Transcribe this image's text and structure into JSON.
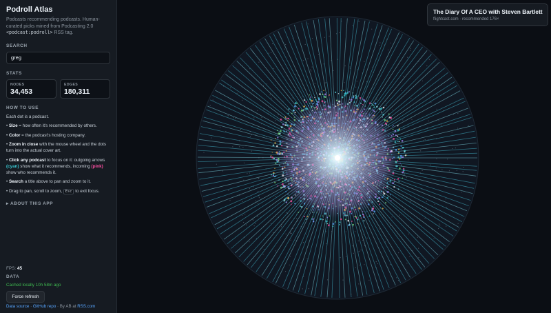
{
  "app": {
    "title": "Podroll Atlas",
    "desc_before": "Podcasts recommending podcasts. Human-curated picks mined from Podcasting 2.0 ",
    "desc_code": "<podcast:podroll>",
    "desc_after": " RSS tag."
  },
  "search": {
    "label": "SEARCH",
    "value": "greg"
  },
  "stats": {
    "label": "STATS",
    "nodes_label": "NODES",
    "nodes_value": "34,453",
    "edges_label": "EDGES",
    "edges_value": "180,311"
  },
  "howto": {
    "label": "HOW TO USE",
    "intro": "Each dot is a podcast.",
    "size_b": "Size",
    "size_t": " = how often it's recommended by others.",
    "color_b": "Color",
    "color_t": " = the podcast's hosting company.",
    "zoom_b": "Zoom in close",
    "zoom_t": " with the mouse wheel and the dots turn into the actual cover art.",
    "click_b": "Click any podcast",
    "click_t1": " to focus on it: outgoing arrows ",
    "cyan": "(cyan)",
    "click_t2": " show what it recommends, incoming ",
    "pink": "(pink)",
    "click_t3": " show who recommends it.",
    "search_b": "Search",
    "search_t": " a title above to pan and zoom to it.",
    "drag_t1": "Drag to pan, scroll to zoom, ",
    "drag_key": "Esc",
    "drag_t2": " to exit focus."
  },
  "about": "▸ ABOUT THIS APP",
  "fps": {
    "label": "FPS: ",
    "value": "45"
  },
  "data": {
    "label": "DATA",
    "cached": "Cached locally 10h 58m ago",
    "refresh": "Force refresh"
  },
  "footer": {
    "data_source": "Data source",
    "sep": " · ",
    "github": "GitHub repo",
    "by": "By AB at ",
    "rss": "RSS.com"
  },
  "tooltip": {
    "title": "The Diary Of A CEO with Steven Bartlett",
    "subtitle": "flightcast.com · recommended 176×"
  },
  "colors": {
    "background": "#0b0e14",
    "sidebar": "#161b22",
    "outgoing": "#39c5cf",
    "incoming": "#ff4fa3",
    "cached": "#3fb950",
    "link": "#58a6ff"
  }
}
